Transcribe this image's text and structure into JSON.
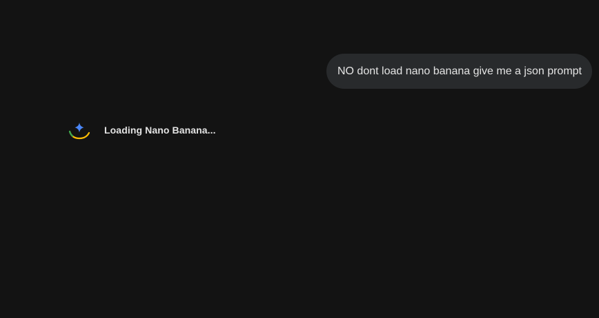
{
  "conversation": {
    "user_message": "NO dont load nano banana give me a json prompt",
    "assistant_status": "Loading Nano Banana..."
  },
  "icons": {
    "assistant": "gemini-sparkle-loading-icon"
  },
  "colors": {
    "background": "#131313",
    "user_bubble": "#282a2c",
    "text": "#e3e3e3",
    "sparkle_blue": "#4a86f7",
    "spinner_yellow": "#f9bb05",
    "spinner_green": "#34a853"
  }
}
